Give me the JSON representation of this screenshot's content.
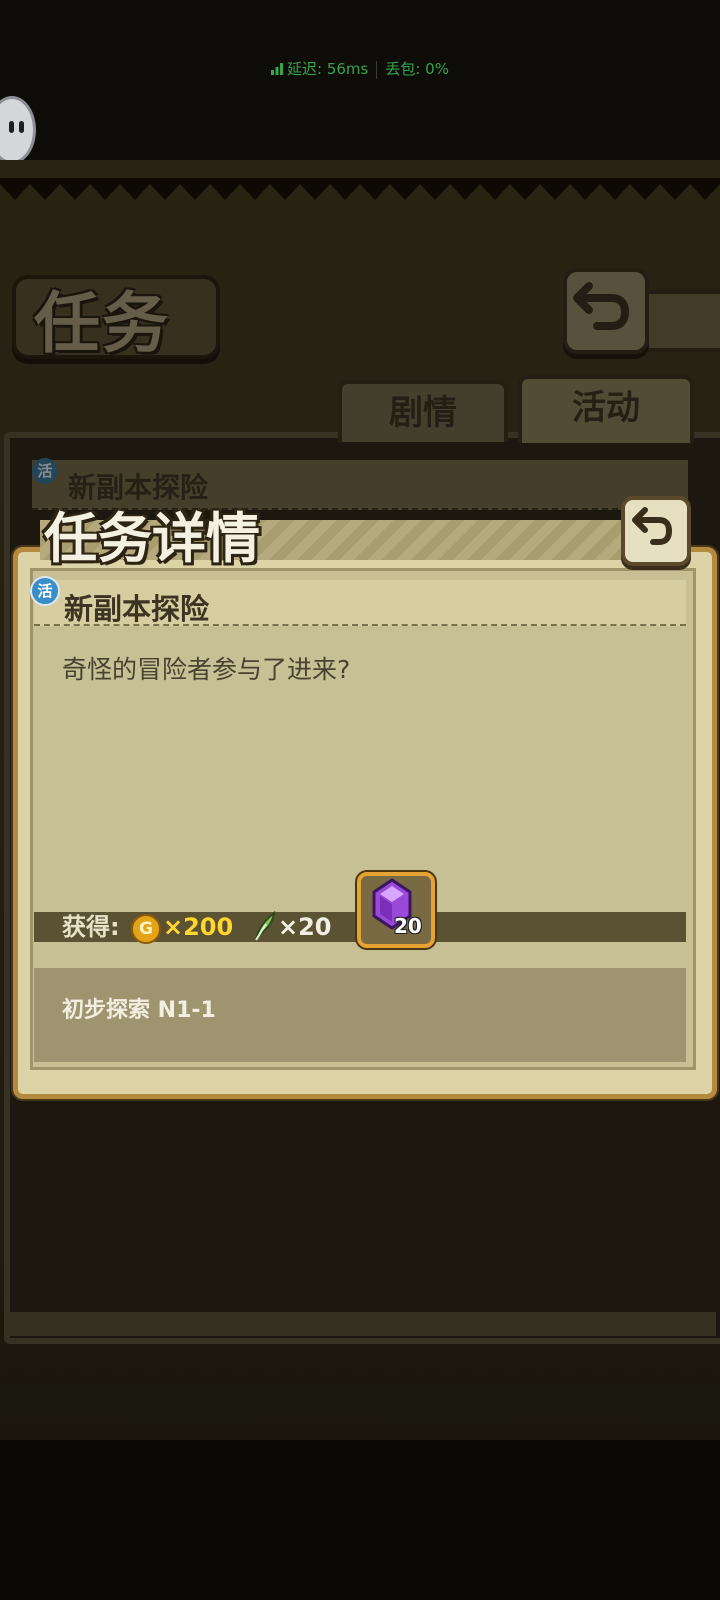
{
  "network": {
    "latency_label": "延迟: 56ms",
    "loss_label": "丢包: 0%"
  },
  "quest_board": {
    "title": "任务",
    "tabs": [
      {
        "label": "剧情"
      },
      {
        "label": "活动"
      }
    ],
    "list_item": {
      "badge": "活",
      "title": "新副本探险"
    }
  },
  "detail": {
    "title": "任务详情",
    "badge": "活",
    "quest_name": "新副本探险",
    "description": "奇怪的冒险者参与了进来?",
    "rewards": {
      "label": "获得:",
      "coin_symbol": "G",
      "coin_amount": "×200",
      "feather_amount": "×20",
      "gem_count": "20"
    },
    "objective": "初步探索 N1-1"
  },
  "colors": {
    "accent_gold": "#e6a233",
    "coin_text": "#ffd52e",
    "latency_green": "#35a54a",
    "gem_purple": "#9a49d8"
  },
  "icons": [
    "signal-bars-icon",
    "floating-assistant-icon",
    "back-arrow-icon",
    "coin-icon",
    "feather-icon",
    "purple-gem-icon"
  ]
}
